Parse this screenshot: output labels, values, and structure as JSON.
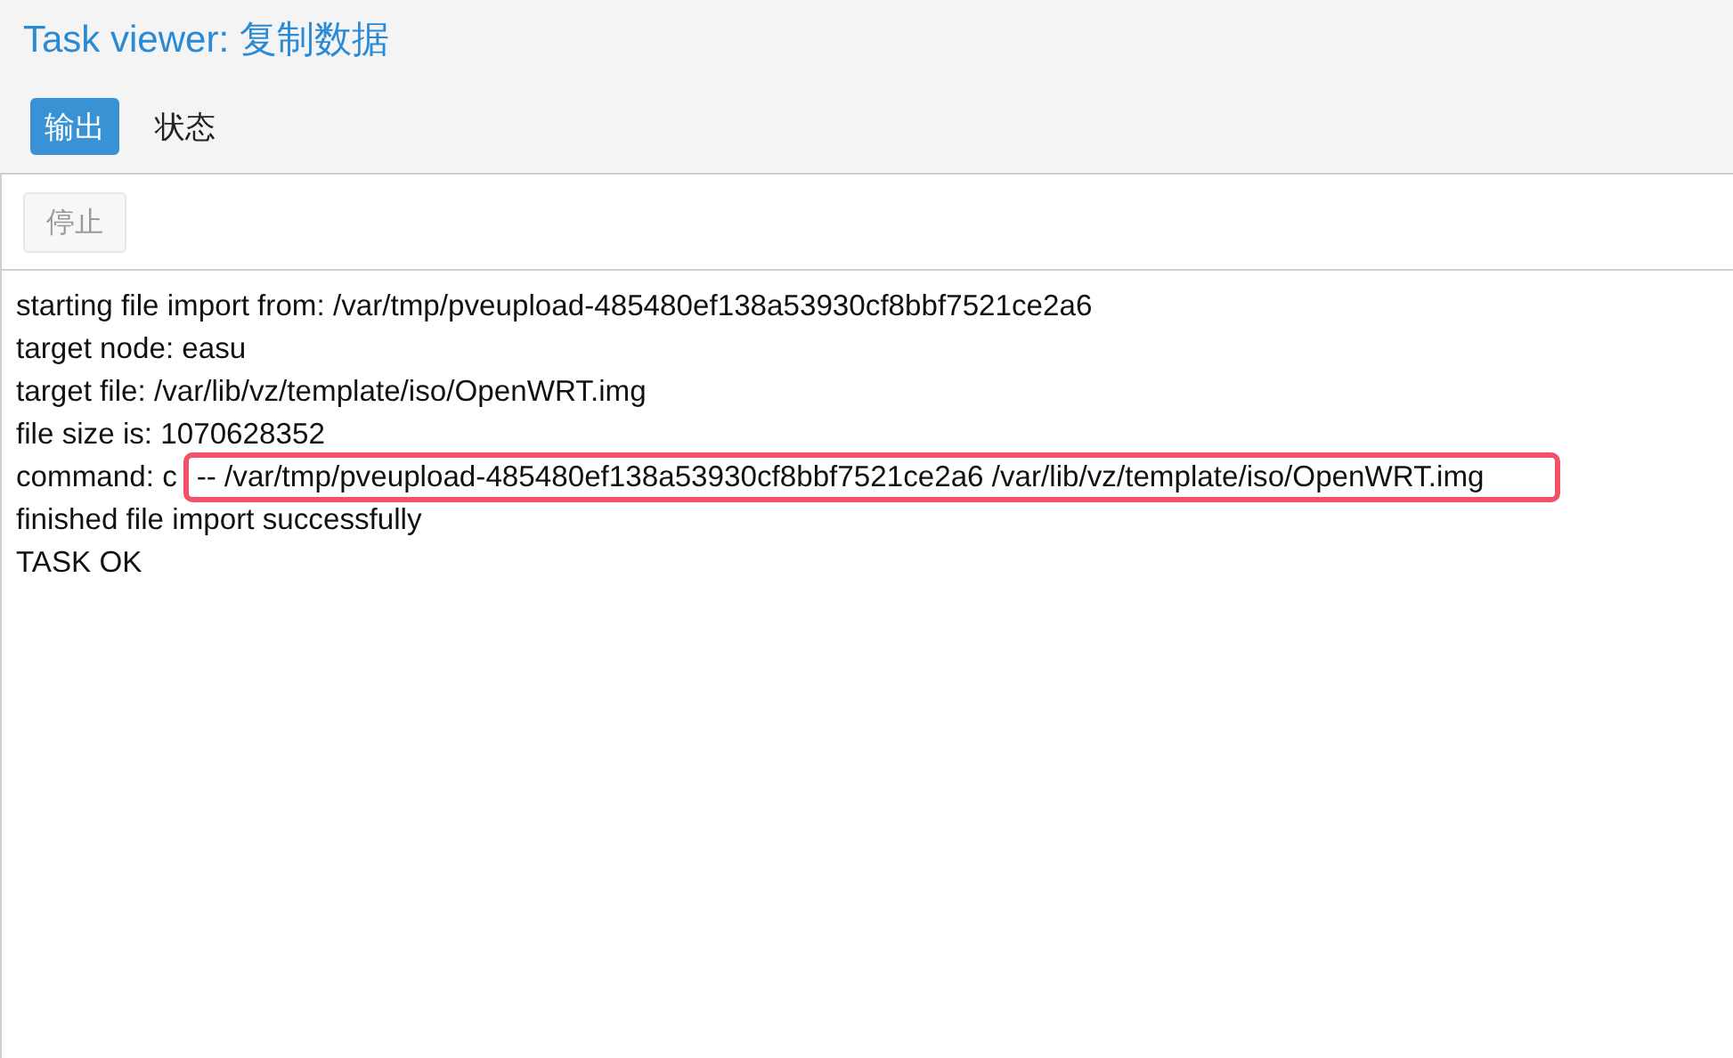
{
  "window": {
    "title": "Task viewer: 复制数据"
  },
  "tabs": [
    {
      "label": "输出",
      "selected": true
    },
    {
      "label": "状态",
      "selected": false
    }
  ],
  "toolbar": {
    "buttons": [
      {
        "label": "停止",
        "disabled": true
      }
    ]
  },
  "log": [
    {
      "text": "starting file import from: /var/tmp/pveupload-485480ef138a53930cf8bbf7521ce2a6"
    },
    {
      "text": "target node: easu"
    },
    {
      "text": "target file: /var/lib/vz/template/iso/OpenWRT.img"
    },
    {
      "text": "file size is: 1070628352"
    },
    {
      "text": "command: c",
      "highlighted_text": "-- /var/tmp/pveupload-485480ef138a53930cf8bbf7521ce2a6 /var/lib/vz/template/iso/OpenWRT.img"
    },
    {
      "text": "finished file import successfully"
    },
    {
      "text": "TASK OK"
    }
  ]
}
